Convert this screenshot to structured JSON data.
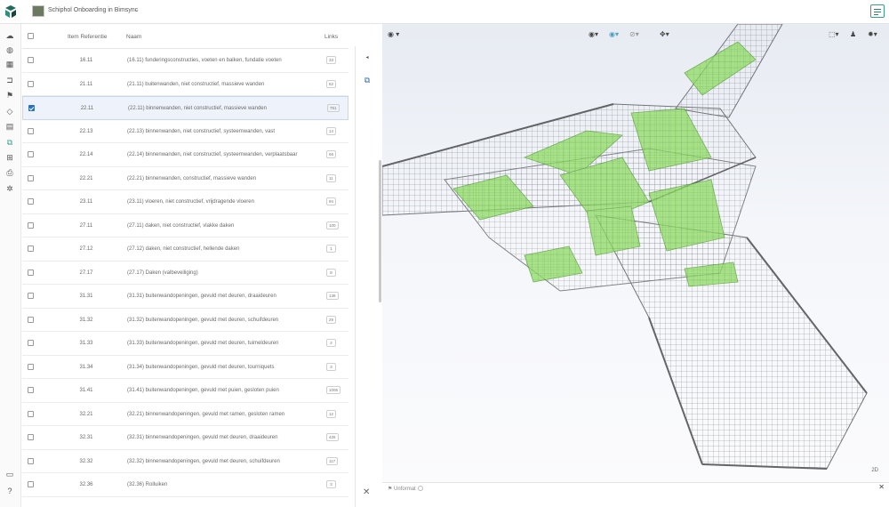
{
  "header": {
    "project_title": "Schiphol Onboarding in Bimsync",
    "caret": "⌄"
  },
  "table": {
    "columns": {
      "ref": "Item Referentie",
      "name": "Naam",
      "links": "Links"
    },
    "rows": [
      {
        "ref": "16.11",
        "name": "(16.11) funderingsconstructies, voeten en balken, fundatie voeten",
        "links": "33",
        "checked": false
      },
      {
        "ref": "21.11",
        "name": "(21.11) buitenwanden, niet constructief, massieve wanden",
        "links": "62",
        "checked": false
      },
      {
        "ref": "22.11",
        "name": "(22.11) binnenwanden, niet constructief, massieve wanden",
        "links": "751",
        "checked": true
      },
      {
        "ref": "22.13",
        "name": "(22.13) binnenwanden, niet constructief, systeemwanden, vast",
        "links": "14",
        "checked": false
      },
      {
        "ref": "22.14",
        "name": "(22.14) binnenwanden, niet constructief, systeemwanden, verplaatsbaar",
        "links": "66",
        "checked": false
      },
      {
        "ref": "22.21",
        "name": "(22.21) binnenwanden, constructief, massieve wanden",
        "links": "11",
        "checked": false
      },
      {
        "ref": "23.11",
        "name": "(23.11) vloeren, niet constructief, vrijdragende vloeren",
        "links": "94",
        "checked": false
      },
      {
        "ref": "27.11",
        "name": "(27.11) daken, niet constructief, vlakke daken",
        "links": "100",
        "checked": false
      },
      {
        "ref": "27.12",
        "name": "(27.12) daken, niet constructief, hellende daken",
        "links": "1",
        "checked": false
      },
      {
        "ref": "27.17",
        "name": "(27.17) Daken (valbeveiliging)",
        "links": "8",
        "checked": false
      },
      {
        "ref": "31.31",
        "name": "(31.31) buitenwandopeningen, gevuld met deuren, draaideuren",
        "links": "138",
        "checked": false
      },
      {
        "ref": "31.32",
        "name": "(31.32) buitenwandopeningen, gevuld met deuren, schuifdeuren",
        "links": "29",
        "checked": false
      },
      {
        "ref": "31.33",
        "name": "(31.33) buitenwandopeningen, gevuld met deuren, tuimeldeuren",
        "links": "2",
        "checked": false
      },
      {
        "ref": "31.34",
        "name": "(31.34) buitenwandopeningen, gevuld met deuren, tourniquets",
        "links": "3",
        "checked": false
      },
      {
        "ref": "31.41",
        "name": "(31.41) buitenwandopeningen, gevuld met puien, gesloten puien",
        "links": "1006",
        "checked": false
      },
      {
        "ref": "32.21",
        "name": "(32.21) binnenwandopeningen, gevuld met ramen, gesloten ramen",
        "links": "12",
        "checked": false
      },
      {
        "ref": "32.31",
        "name": "(32.31) binnenwandopeningen, gevuld met deuren, draaideuren",
        "links": "426",
        "checked": false
      },
      {
        "ref": "32.32",
        "name": "(32.32) binnenwandopeningen, gevuld met deuren, schuifdeuren",
        "links": "117",
        "checked": false
      },
      {
        "ref": "32.36",
        "name": "(32.36) Rolluiken",
        "links": "3",
        "checked": false
      }
    ]
  },
  "viewer": {
    "mode_label": "2D",
    "filter_label": "Unformat",
    "highlight_color": "#7ed957",
    "model_color": "#7d7f83"
  }
}
